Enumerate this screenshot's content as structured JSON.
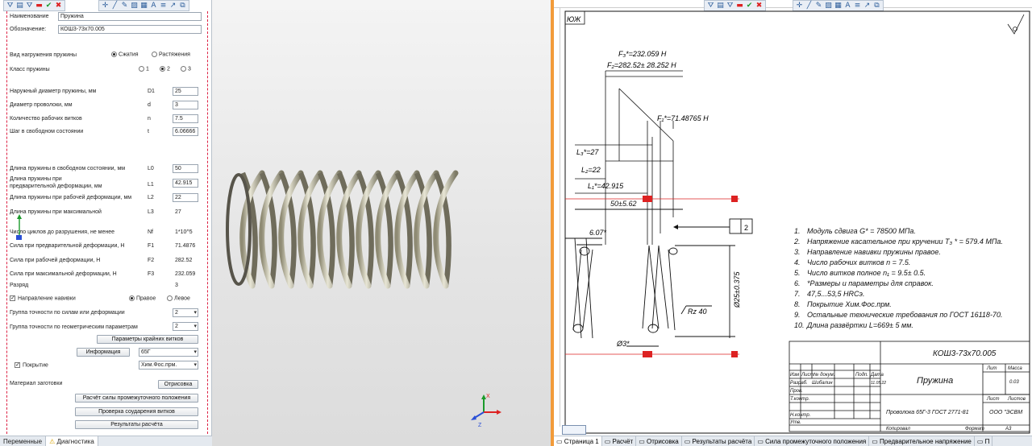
{
  "panel": {
    "top_label_cut": "Наименование",
    "top_value_cut": "Пружина",
    "designation_label": "Обозначение:",
    "designation_value": "КОШ3-73х70.005",
    "load_type_label": "Вид нагружения пружины",
    "load_compression": "Сжатия",
    "load_tension": "Растяжения",
    "spring_class_label": "Класс пружины",
    "class_options": [
      "1",
      "2",
      "3"
    ],
    "params": [
      {
        "label": "Наружный диаметр пружины, мм",
        "sym": "D1",
        "value": "25"
      },
      {
        "label": "Диаметр проволоки, мм",
        "sym": "d",
        "value": "3"
      },
      {
        "label": "Количество рабочих витков",
        "sym": "n",
        "value": "7.5"
      },
      {
        "label": "Шаг в свободном состоянии",
        "sym": "t",
        "value": "6.06666"
      },
      {
        "label": "Длина пружины в свободном состоянии, мм",
        "sym": "L0",
        "value": "50"
      },
      {
        "label": "Длина пружины при",
        "label2": "предварительной деформации, мм",
        "sym": "L1",
        "value": "42.915"
      },
      {
        "label": "Длина пружины при рабочей деформации, мм",
        "sym": "L2",
        "value": "22"
      },
      {
        "label": "Длина пружины при максимальной",
        "sym": "L3",
        "value": "27"
      },
      {
        "label": "Число циклов до разрушения, не менее",
        "sym": "Nf",
        "value": "1*10^5"
      },
      {
        "label": "Сила при предварительной деформации, Н",
        "sym": "F1",
        "value": "71.4876"
      },
      {
        "label": "Сила при рабочей деформации, Н",
        "sym": "F2",
        "value": "282.52"
      },
      {
        "label": "Сила при максимальной деформации, Н",
        "sym": "F3",
        "value": "232.059"
      },
      {
        "label": "Разряд",
        "sym": "",
        "value": "3"
      }
    ],
    "winding_label": "Направление навивки",
    "winding_right": "Правое",
    "winding_left": "Левое",
    "force_accuracy_label": "Группа точности по силам или деформации",
    "force_accuracy_value": "2",
    "geom_accuracy_label": "Группа точности по геометрическим параметрам",
    "geom_accuracy_value": "2",
    "end_coils_button": "Параметры крайних витков",
    "info_button": "Информация",
    "material_value": "65Г",
    "coating_label": "Покрытие",
    "coating_value": "Хим.Фос.прм.",
    "blank_material_label": "Материал заготовки",
    "draw_button": "Отрисовка",
    "intermediate_button": "Расчёт силы промежуточного положения",
    "check_coils_button": "Проверка соударения витков",
    "results_button": "Результаты расчёта",
    "tab_variables": "Переменные",
    "tab_diagnostics": "Диагностика"
  },
  "drawing": {
    "corner_cut": "ЮЖ",
    "dims": {
      "f3": "F₃*=232.059 Н",
      "f2": "F₂=282.52± 28.252 Н",
      "f1": "F₁*=71.48765 Н",
      "l3": "L₃*=27",
      "l2": "L₂=22",
      "l1": "L₁*=42.915",
      "l0": "50±5.62",
      "pitch": "6.07*",
      "wire": "Ø3*",
      "dia": "Ø25±0.375",
      "rz": "Rz 40",
      "tol_box": "2"
    },
    "notes": [
      "Модуль сдвига G* = 78500 МПа.",
      "Напряжение касательное при кручении Τ₃ * = 579.4 МПа.",
      "Направление навивки пружины правое.",
      "Число рабочих витков n = 7.5.",
      "Число витков полное n₁ = 9.5± 0.5.",
      "*Размеры и параметры для справок.",
      "47,5...53,5 HRCэ.",
      "Покрытие Хим.Фос.прм.",
      "Остальные технические требования по ГОСТ 16118-70.",
      "Длина развёртки L=669± 5 мм."
    ],
    "note_numbers": [
      "1.",
      "2.",
      "3.",
      "4.",
      "5.",
      "6.",
      "7.",
      "8.",
      "9.",
      "10."
    ],
    "title_block": {
      "code": "КОШ3-73х70.005",
      "name": "Пружина",
      "material": "Проволока 65Г-3 ГОСТ 2771-81",
      "company": "ООО \"ЭСВМ",
      "lit": "Лит",
      "mass": "Масса",
      "mass_value": "0.03",
      "sheet": "Лист",
      "sheets": "Листов",
      "copied": "Копировал",
      "format": "Формат",
      "format_value": "А3",
      "hdr_izm": "Изм",
      "hdr_list": "Лист",
      "hdr_doc": "№ докум.",
      "hdr_sign": "Подп.",
      "hdr_date": "Дата",
      "razrab": "Разраб.",
      "razrab_name": "Шибалин",
      "razrab_date": "11.05.22",
      "prov": "Пров.",
      "tkontr": "Т.контр.",
      "nkontr": "Н.контр.",
      "utv": "Утв."
    },
    "tabs": [
      "Страница 1",
      "Расчёт",
      "Отрисовка",
      "Результаты расчёта",
      "Сила промежуточного положения",
      "Предварительное напряжение",
      "П"
    ]
  },
  "viewport": {
    "triad_x": "X",
    "triad_y": "Y",
    "triad_z": "Z"
  }
}
